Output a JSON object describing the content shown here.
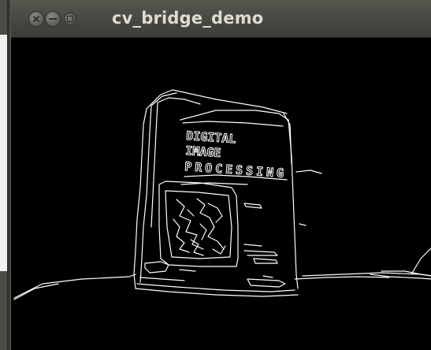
{
  "background_window": {},
  "window": {
    "title": "cv_bridge_demo",
    "buttons": [
      "close",
      "minimize",
      "maximize"
    ]
  },
  "image": {
    "description_icon": "canny-edge-image",
    "book_cover_text": [
      "DIGITAL",
      "IMAGE",
      "PROCESSING"
    ]
  }
}
